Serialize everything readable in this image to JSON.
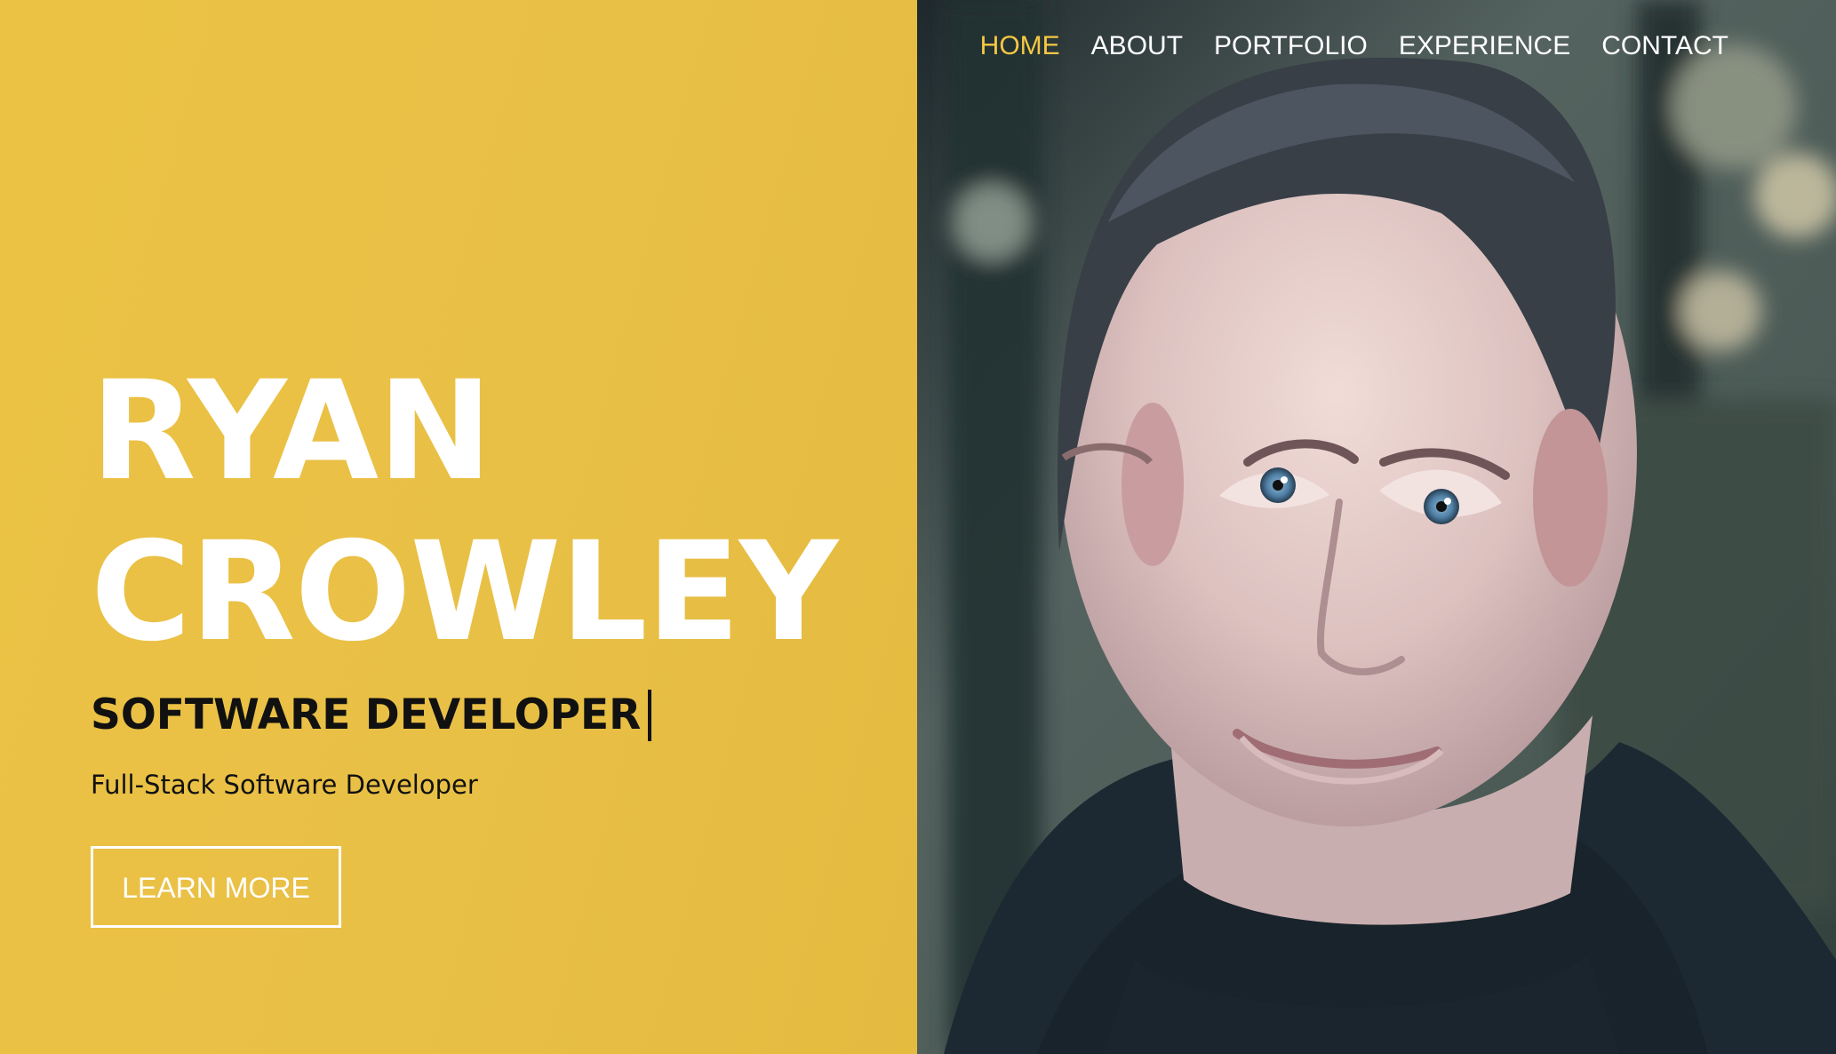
{
  "colors": {
    "accent": "#EBC244",
    "active_nav": "#F5C843",
    "text_light": "#FFFFFF",
    "text_dark": "#111111"
  },
  "nav": {
    "items": [
      {
        "label": "HOME",
        "active": true
      },
      {
        "label": "ABOUT",
        "active": false
      },
      {
        "label": "PORTFOLIO",
        "active": false
      },
      {
        "label": "EXPERIENCE",
        "active": false
      },
      {
        "label": "CONTACT",
        "active": false
      }
    ]
  },
  "hero": {
    "first_name": "RYAN",
    "last_name": "CROWLEY",
    "role": "SOFTWARE DEVELOPER",
    "summary": "Full-Stack Software Developer",
    "cta_label": "LEARN MORE"
  },
  "photo": {
    "subject": "portrait-of-smiling-man"
  }
}
